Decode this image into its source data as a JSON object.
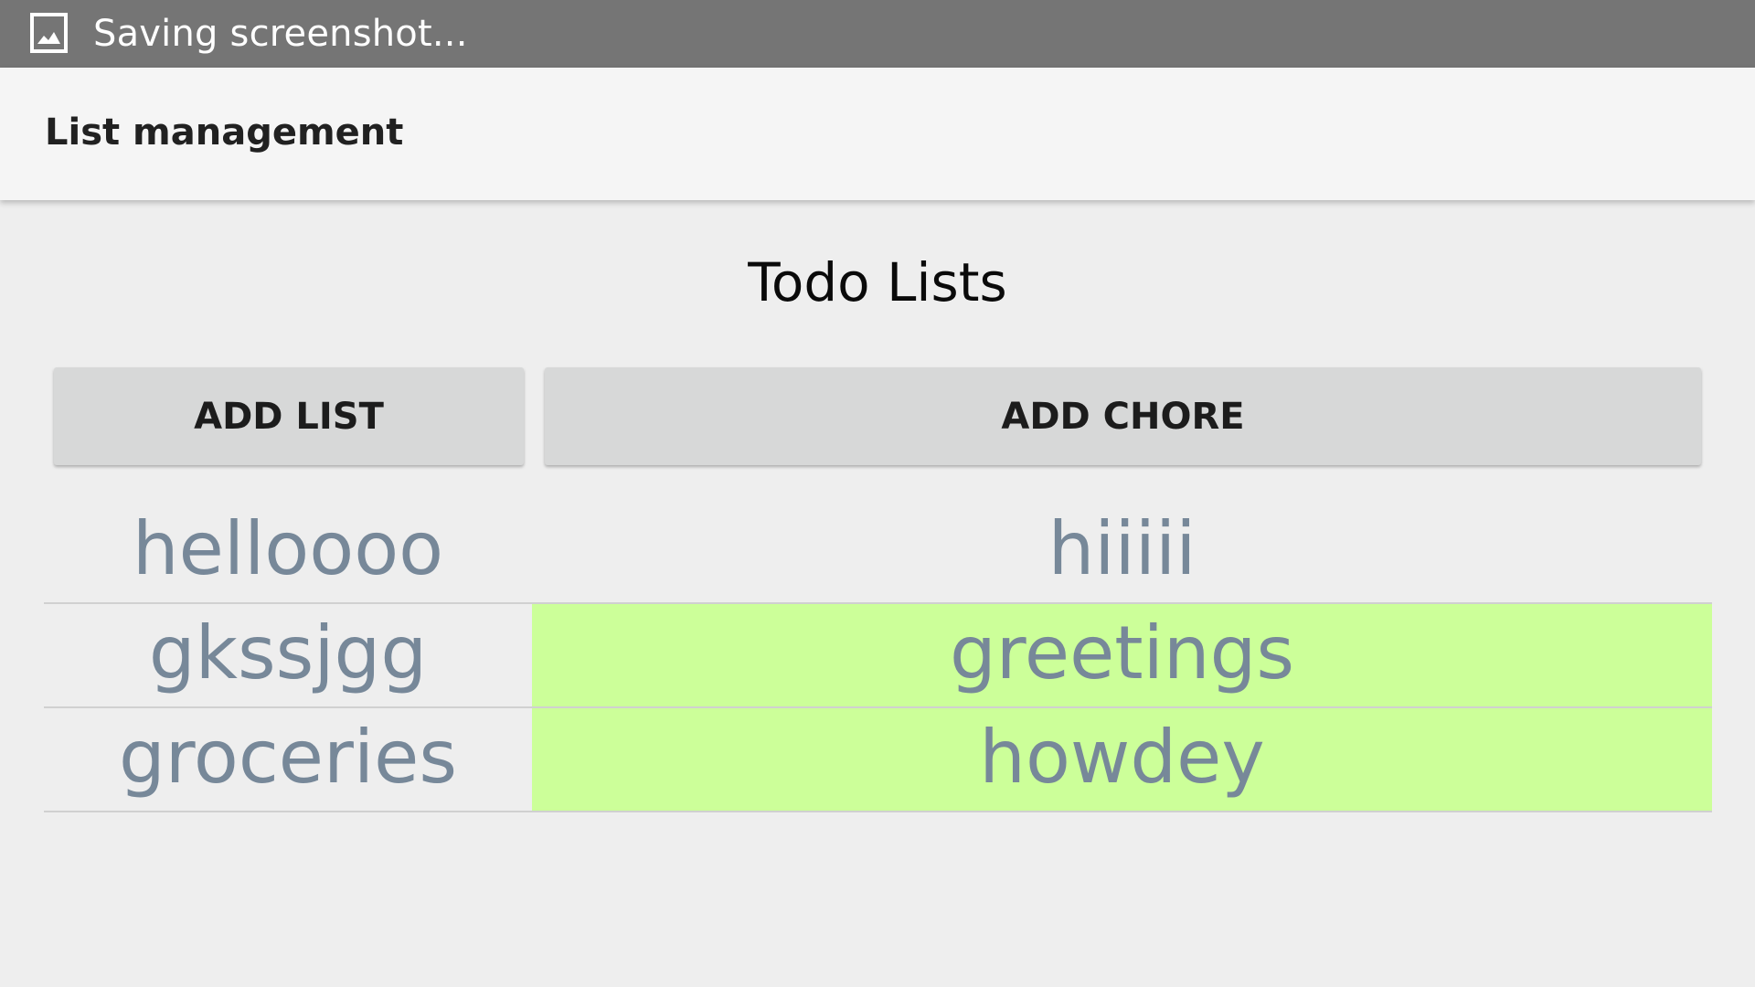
{
  "status_bar": {
    "icon": "image-icon",
    "text": "Saving screenshot..."
  },
  "action_bar": {
    "title": "List management"
  },
  "main": {
    "heading": "Todo Lists",
    "add_list_label": "ADD LIST",
    "add_chore_label": "ADD CHORE",
    "highlight_color": "#ccff99",
    "text_color": "#778899",
    "rows": [
      {
        "left": "helloooo",
        "right": "hiiiii",
        "right_highlighted": false
      },
      {
        "left": "gkssjgg",
        "right": "greetings",
        "right_highlighted": true
      },
      {
        "left": "groceries",
        "right": "howdey",
        "right_highlighted": true
      }
    ]
  }
}
